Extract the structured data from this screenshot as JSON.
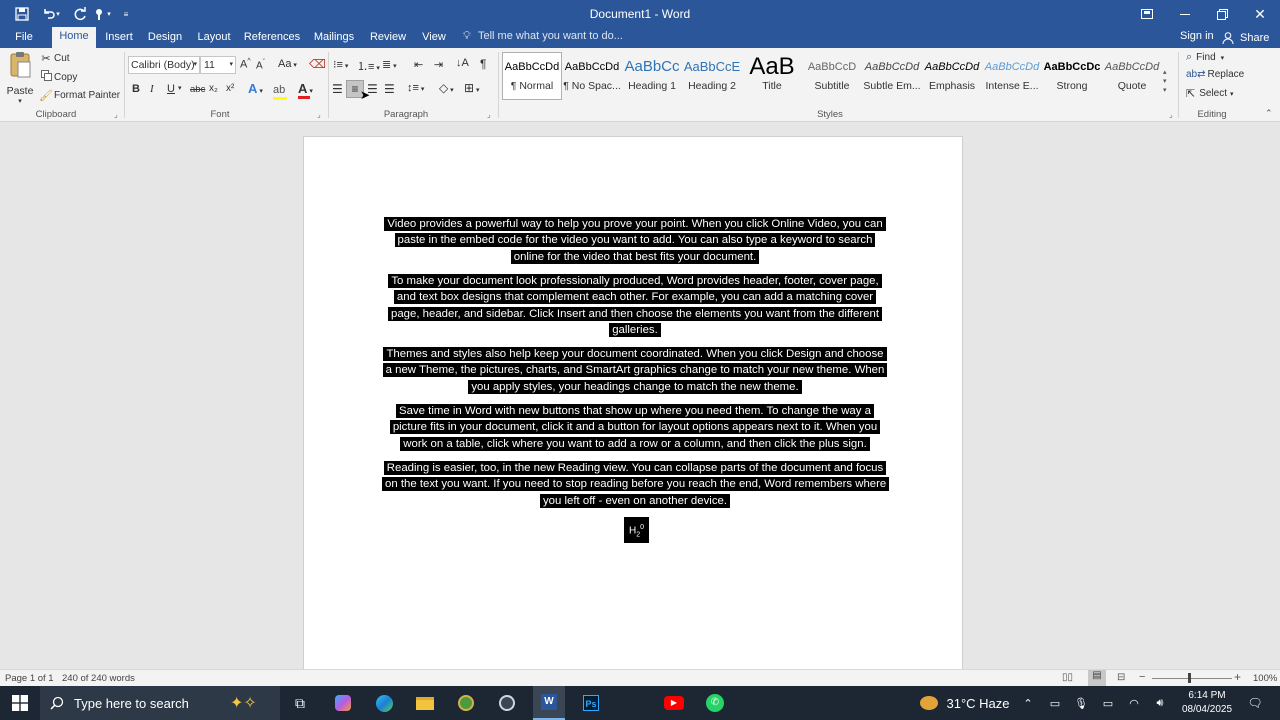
{
  "titlebar": {
    "title": "Document1 - Word"
  },
  "tabs": {
    "file": "File",
    "home": "Home",
    "insert": "Insert",
    "design": "Design",
    "layout": "Layout",
    "references": "References",
    "mailings": "Mailings",
    "review": "Review",
    "view": "View",
    "tell_me": "Tell me what you want to do...",
    "sign_in": "Sign in",
    "share": "Share"
  },
  "clipboard": {
    "paste": "Paste",
    "cut": "Cut",
    "copy": "Copy",
    "format_painter": "Format Painter",
    "label": "Clipboard"
  },
  "font": {
    "name": "Calibri (Body)",
    "size": "11",
    "bold": "B",
    "italic": "I",
    "underline": "U",
    "strike": "abc",
    "sub": "x₂",
    "sup": "x²",
    "case": "Aa",
    "grow": "A",
    "shrink": "A",
    "label": "Font"
  },
  "paragraph": {
    "label": "Paragraph"
  },
  "styles": {
    "label": "Styles",
    "items": [
      {
        "preview": "AaBbCcDd",
        "name": "¶ Normal"
      },
      {
        "preview": "AaBbCcDd",
        "name": "¶ No Spac..."
      },
      {
        "preview": "AaBbCc",
        "name": "Heading 1"
      },
      {
        "preview": "AaBbCcE",
        "name": "Heading 2"
      },
      {
        "preview": "AaB",
        "name": "Title"
      },
      {
        "preview": "AaBbCcD",
        "name": "Subtitle"
      },
      {
        "preview": "AaBbCcDd",
        "name": "Subtle Em..."
      },
      {
        "preview": "AaBbCcDd",
        "name": "Emphasis"
      },
      {
        "preview": "AaBbCcDd",
        "name": "Intense E..."
      },
      {
        "preview": "AaBbCcDc",
        "name": "Strong"
      },
      {
        "preview": "AaBbCcDd",
        "name": "Quote"
      }
    ]
  },
  "editing": {
    "find": "Find",
    "replace": "Replace",
    "select": "Select",
    "label": "Editing"
  },
  "document": {
    "paragraphs": [
      "Video provides a powerful way to help you prove your point. When you click Online Video, you can paste in the embed code for the video you want to add. You can also type a keyword to search online for the video that best fits your document.",
      "To make your document look professionally produced, Word provides header, footer, cover page, and text box designs that complement each other. For example, you can add a matching cover page, header, and sidebar. Click Insert and then choose the elements you want from the different galleries.",
      "Themes and styles also help keep your document coordinated. When you click Design and choose a new Theme, the pictures, charts, and SmartArt graphics change to match your new theme. When you apply styles, your headings change to match the new theme.",
      "Save time in Word with new buttons that show up where you need them. To change the way a picture fits in your document, click it and a button for layout options appears next to it. When you work on a table, click where you want to add a row or a column, and then click the plus sign.",
      "Reading is easier, too, in the new Reading view. You can collapse parts of the document and focus on the text you want. If you need to stop reading before you reach the end, Word remembers where you left off - even on another device."
    ],
    "formula_base": "H",
    "formula_sub": "2",
    "formula_sup": "0"
  },
  "status": {
    "page": "Page 1 of 1",
    "words": "240 of 240 words",
    "zoom": "100%"
  },
  "taskbar": {
    "search_placeholder": "Type here to search",
    "weather": "31°C  Haze",
    "time": "6:14 PM",
    "date": "08/04/2025"
  },
  "colors": {
    "accent": "#2b579a",
    "heading": "#2e74b5",
    "intense": "#5b9bd5"
  }
}
